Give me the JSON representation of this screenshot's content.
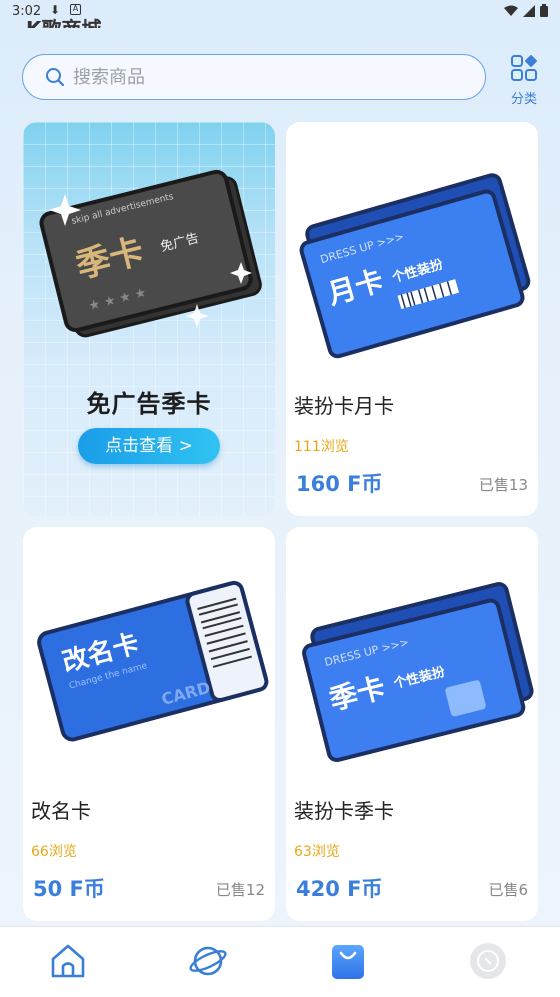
{
  "status_bar": {
    "time": "3:02"
  },
  "header": {
    "partial_title": "K歌商城"
  },
  "search": {
    "placeholder": "搜索商品"
  },
  "category": {
    "label": "分类"
  },
  "promo": {
    "card_text": "季卡",
    "card_tag": "免广告",
    "card_small": "skip all advertisements",
    "title": "免广告季卡",
    "button_label": "点击查看 >"
  },
  "products": [
    {
      "name": "装扮卡月卡",
      "views": "111浏览",
      "price": "160 F币",
      "sold": "已售13",
      "card_big": "月卡",
      "card_tag": "个性装扮",
      "card_top": "DRESS UP >>>"
    },
    {
      "name": "改名卡",
      "views": "66浏览",
      "price": "50 F币",
      "sold": "已售12",
      "card_big": "改名卡",
      "card_sub": "Change the name",
      "card_tag": "CARD"
    },
    {
      "name": "装扮卡季卡",
      "views": "63浏览",
      "price": "420 F币",
      "sold": "已售6",
      "card_big": "季卡",
      "card_tag": "个性装扮",
      "card_top": "DRESS UP >>>"
    }
  ],
  "nav": {
    "items": [
      "home-icon",
      "planet-icon",
      "shopping-bag-icon",
      "profile-icon"
    ],
    "active": "shopping-bag-icon"
  },
  "colors": {
    "accent": "#3b7fdd",
    "views": "#e6a817",
    "promo_button": "#1a9de8"
  }
}
